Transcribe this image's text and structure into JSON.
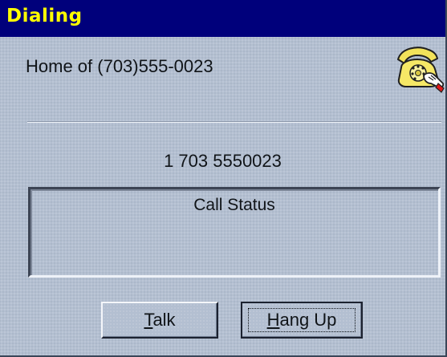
{
  "window": {
    "title": "Dialing"
  },
  "contact": {
    "label": "Home of (703)555-0023"
  },
  "dialed_number": "1 703 5550023",
  "status_box": {
    "label": "Call Status"
  },
  "buttons": {
    "talk": {
      "mnemonic": "T",
      "rest": "alk"
    },
    "hangup": {
      "mnemonic": "H",
      "rest": "ang Up"
    }
  },
  "icons": {
    "phone": "telephone-with-hand-icon"
  },
  "colors": {
    "title_bar": "#00007b",
    "title_text": "#ffff00",
    "dialog_bg": "#b3bfd1"
  }
}
